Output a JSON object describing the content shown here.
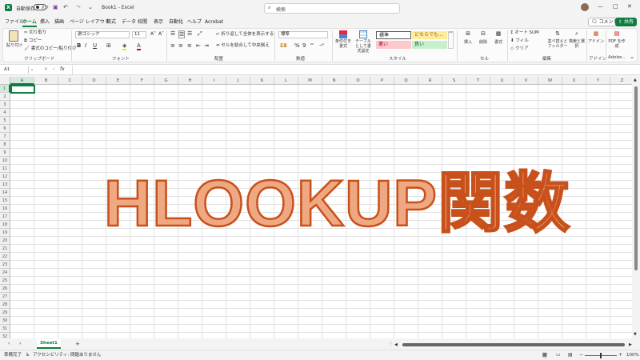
{
  "titlebar": {
    "autosave_label": "自動保存",
    "autosave_state": "オフ",
    "book_title": "Book1 - Excel",
    "search_placeholder": "検索",
    "comment_label": "コメント",
    "share_label": "共有"
  },
  "menu": [
    "ファイル",
    "ホーム",
    "挿入",
    "描画",
    "ページ レイアウト",
    "数式",
    "データ",
    "校閲",
    "表示",
    "自動化",
    "ヘルプ",
    "Acrobat"
  ],
  "active_menu": "ホーム",
  "ribbon": {
    "clipboard": {
      "paste": "貼り付け",
      "cut": "切り取り",
      "copy": "コピー",
      "format_painter": "書式のコピー/貼り付け",
      "label": "クリップボード"
    },
    "font": {
      "name": "游ゴシック",
      "size": "11",
      "label": "フォント"
    },
    "alignment": {
      "wrap": "折り返して全体を表示する",
      "merge": "セルを結合して中央揃え",
      "label": "配置"
    },
    "number": {
      "format": "標準",
      "label": "数値"
    },
    "styles": {
      "conditional": "条件付き書式",
      "table": "テーブルとして書式設定",
      "standard": "標準",
      "neutral": "どちらでも...",
      "bad": "悪い",
      "good": "良い",
      "label": "スタイル"
    },
    "cells": {
      "insert": "挿入",
      "delete": "削除",
      "format": "書式",
      "label": "セル"
    },
    "editing": {
      "autosum": "オート SUM",
      "fill": "フィル",
      "clear": "クリア",
      "sort": "並べ替えとフィルター",
      "find": "検索と選択",
      "label": "編集"
    },
    "addins": {
      "addin": "アドイン",
      "label": "アドイン"
    },
    "adobe": {
      "pdf": "PDF を作成",
      "label": "Adobe..."
    }
  },
  "formula_bar": {
    "name_box": "A1",
    "fx": "fx",
    "value": ""
  },
  "columns": [
    "A",
    "B",
    "C",
    "D",
    "E",
    "F",
    "G",
    "H",
    "I",
    "J",
    "K",
    "L",
    "M",
    "N",
    "O",
    "P",
    "Q",
    "R",
    "S",
    "T",
    "U",
    "V",
    "W",
    "X",
    "Y",
    "Z"
  ],
  "rows": [
    "1",
    "2",
    "3",
    "4",
    "5",
    "6",
    "7",
    "8",
    "9",
    "10",
    "11",
    "12",
    "13",
    "14",
    "15",
    "16",
    "17",
    "18",
    "19",
    "20",
    "21",
    "22",
    "23",
    "24",
    "25",
    "26",
    "27",
    "28",
    "29",
    "30",
    "31",
    "32"
  ],
  "overlay_text": "HLOOKUP関数",
  "sheet_tab": "Sheet1",
  "status": {
    "ready": "準備完了",
    "accessibility": "アクセシビリティ: 問題ありません",
    "zoom": "100%"
  },
  "colors": {
    "accent": "#107c41",
    "overlay_fill": "#eea882",
    "overlay_stroke": "#c8501a",
    "bad_bg": "#ffc7ce",
    "neutral_bg": "#ffeb9c",
    "good_bg": "#c6efce"
  }
}
